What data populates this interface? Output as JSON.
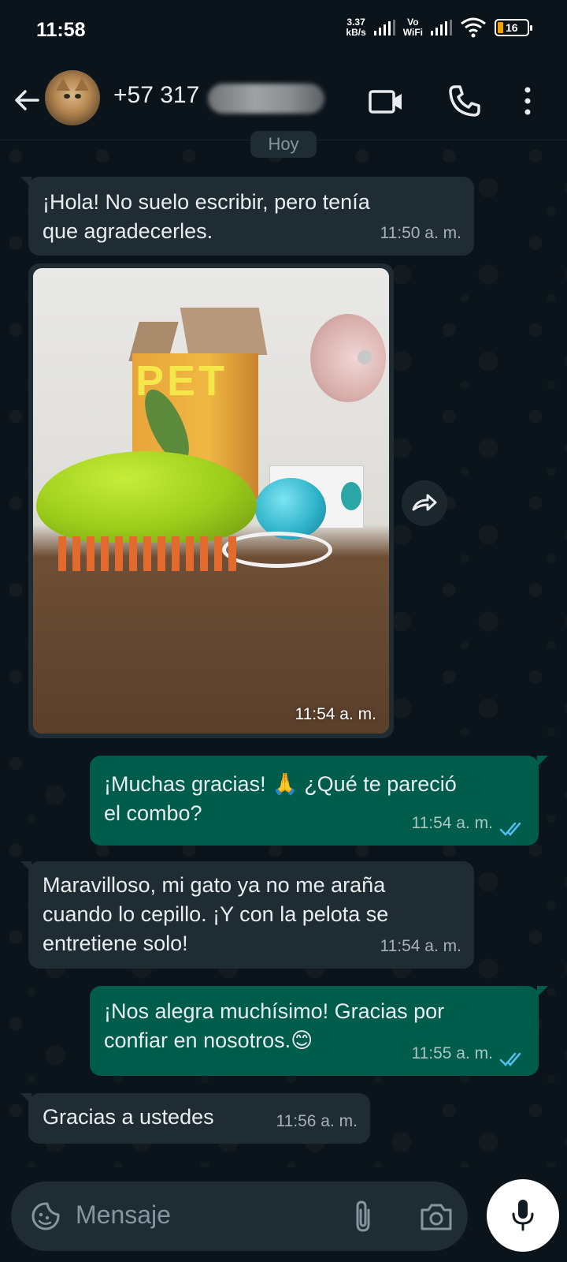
{
  "status_bar": {
    "time": "11:58",
    "net_speed_value": "3.37",
    "net_speed_unit": "kB/s",
    "vo": "Vo",
    "wifi_label": "WiFi",
    "battery": "16",
    "battery_color": "#f2a300"
  },
  "header": {
    "contact_name": "+57 317",
    "icons": [
      "back-arrow-icon",
      "video-call-icon",
      "phone-call-icon",
      "more-options-icon"
    ]
  },
  "chat": {
    "date_label": "Hoy",
    "messages": [
      {
        "direction": "in",
        "line1": "¡Hola! No suelo escribir, pero tenía",
        "line2": "que agradecerles.",
        "time": "11:50 a. m."
      },
      {
        "direction": "in",
        "type": "image",
        "time": "11:54 a. m.",
        "photo_text": "PET"
      },
      {
        "direction": "out",
        "line1": "¡Muchas gracias! 🙏 ¿Qué te pareció",
        "line2": "el combo?",
        "time": "11:54 a. m.",
        "status": "read"
      },
      {
        "direction": "in",
        "line1": "Maravilloso, mi gato ya no me araña",
        "line2": "cuando lo cepillo. ¡Y con la pelota se",
        "line3": "entretiene solo!",
        "time": "11:54 a. m."
      },
      {
        "direction": "out",
        "line1": "¡Nos alegra muchísimo! Gracias por",
        "line2": "confiar en nosotros.😊",
        "time": "11:55 a. m.",
        "status": "read"
      },
      {
        "direction": "in",
        "line1": "Gracias a ustedes",
        "time": "11:56 a. m."
      }
    ]
  },
  "composer": {
    "placeholder": "Mensaje",
    "icons": [
      "sticker-icon",
      "attach-icon",
      "camera-icon",
      "mic-icon"
    ]
  },
  "colors": {
    "background": "#0b141a",
    "incoming_bubble": "#1f2c33",
    "outgoing_bubble": "#005c4b",
    "read_ticks": "#53bdeb"
  }
}
